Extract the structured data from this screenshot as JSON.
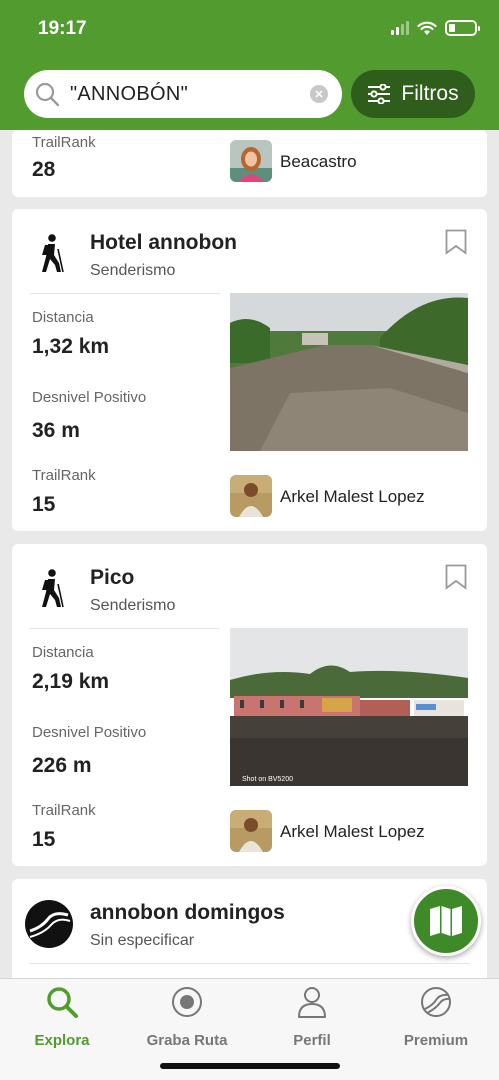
{
  "status": {
    "time": "19:17"
  },
  "search": {
    "query": "\"ANNOBÓN\""
  },
  "filters": {
    "label": "Filtros"
  },
  "top_card": {
    "trailrank_label": "TrailRank",
    "trailrank": "28",
    "author": "Beacastro"
  },
  "trails": [
    {
      "title": "Hotel annobon",
      "activity": "Senderismo",
      "distance_label": "Distancia",
      "distance": "1,32 km",
      "elevation_label": "Desnivel Positivo",
      "elevation": "36 m",
      "trailrank_label": "TrailRank",
      "trailrank": "15",
      "author": "Arkel Malest Lopez"
    },
    {
      "title": "Pico",
      "activity": "Senderismo",
      "distance_label": "Distancia",
      "distance": "2,19 km",
      "elevation_label": "Desnivel Positivo",
      "elevation": "226 m",
      "trailrank_label": "TrailRank",
      "trailrank": "15",
      "author": "Arkel Malest Lopez",
      "photo_caption": "Shot on BV5200"
    }
  ],
  "bottom_card": {
    "title": "annobon domingos",
    "activity": "Sin especificar"
  },
  "tabs": [
    {
      "label": "Explora",
      "icon": "search-icon",
      "active": true
    },
    {
      "label": "Graba Ruta",
      "icon": "record-icon",
      "active": false
    },
    {
      "label": "Perfil",
      "icon": "profile-icon",
      "active": false
    },
    {
      "label": "Premium",
      "icon": "premium-icon",
      "active": false
    }
  ],
  "colors": {
    "brand_green": "#529c2f",
    "dark_green": "#2f5e1c",
    "fab_green": "#3e8a28"
  }
}
